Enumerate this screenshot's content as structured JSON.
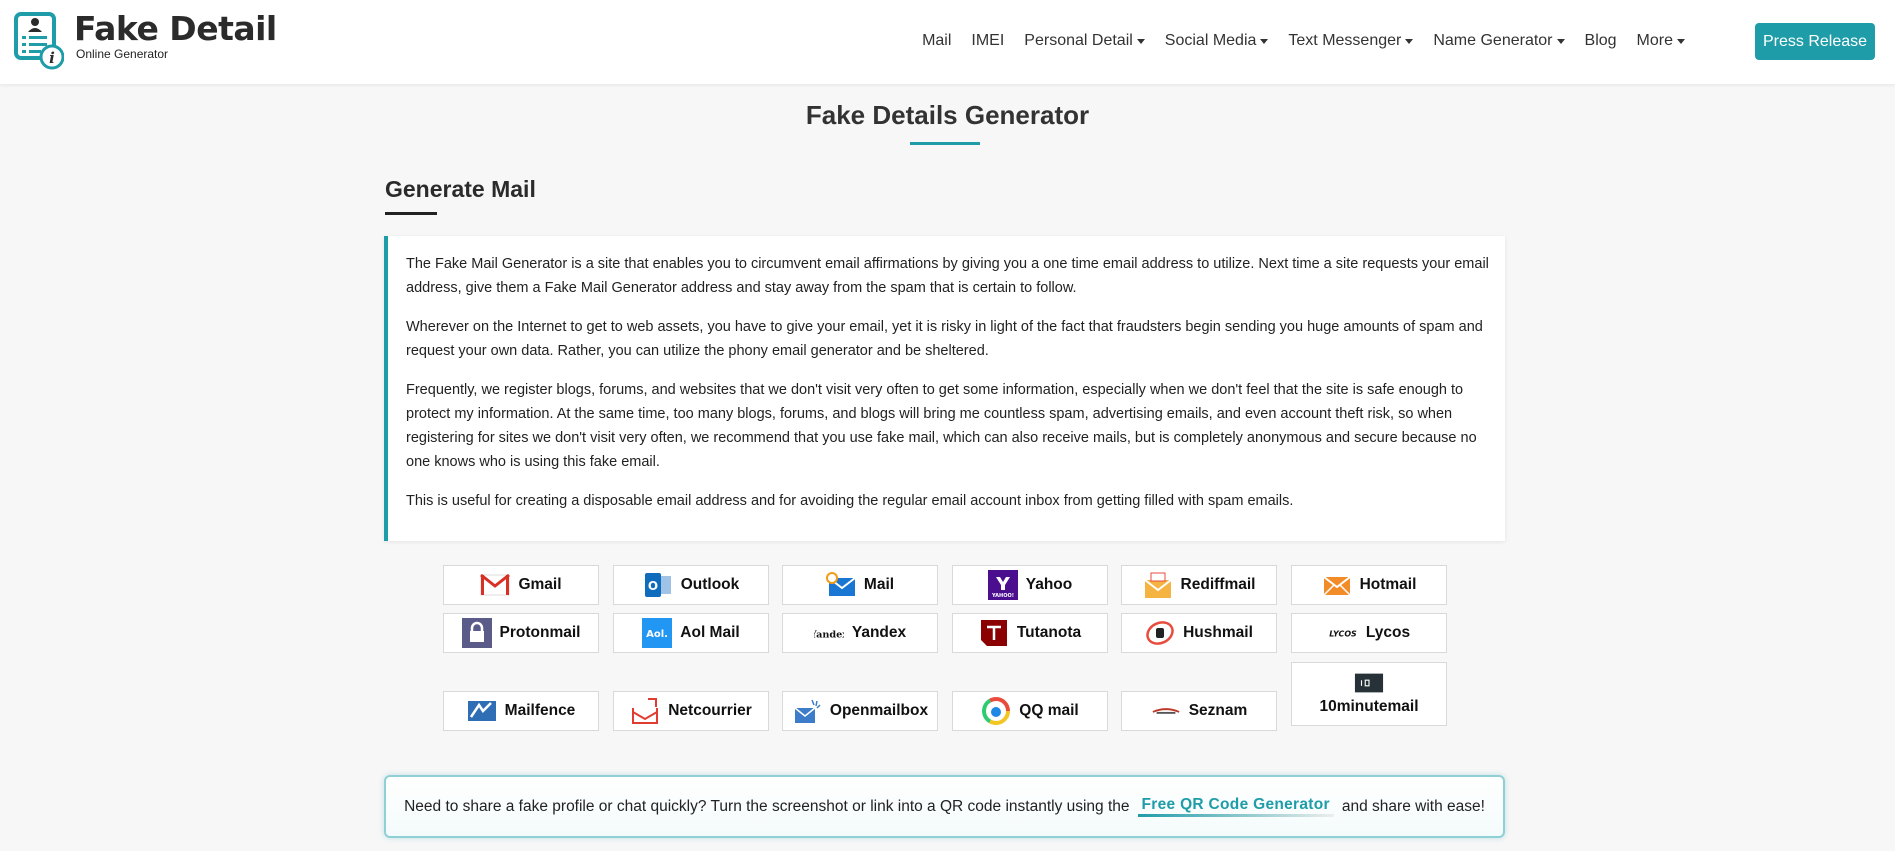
{
  "brand": {
    "title": "Fake Detail",
    "subtitle": "Online Generator"
  },
  "nav": {
    "items": [
      {
        "label": "Mail",
        "dropdown": false
      },
      {
        "label": "IMEI",
        "dropdown": false
      },
      {
        "label": "Personal Detail",
        "dropdown": true
      },
      {
        "label": "Social Media",
        "dropdown": true
      },
      {
        "label": "Text Messenger",
        "dropdown": true
      },
      {
        "label": "Name Generator",
        "dropdown": true
      },
      {
        "label": "Blog",
        "dropdown": false
      },
      {
        "label": "More",
        "dropdown": true
      }
    ],
    "press_release": "Press Release"
  },
  "page": {
    "title": "Fake Details Generator",
    "section_title": "Generate Mail"
  },
  "description": [
    "The Fake Mail Generator is a site that enables you to circumvent email affirmations by giving you a one time email address to utilize. Next time a site requests your email address, give them a Fake Mail Generator address and stay away from the spam that is certain to follow.",
    "Wherever on the Internet to get to web assets, you have to give your email, yet it is risky in light of the fact that fraudsters begin sending you huge amounts of spam and request your own data. Rather, you can utilize the phony email generator and be sheltered.",
    "Frequently, we register blogs, forums, and websites that we don't visit very often to get some information, especially when we don't feel that the site is safe enough to protect my information. At the same time, too many blogs, forums, and blogs will bring me countless spam, advertising emails, and even account theft risk, so when registering for sites we don't visit very often, we recommend that you use fake mail, which can also receive mails, but is completely anonymous and secure because no one knows who is using this fake email.",
    "This is useful for creating a disposable email address and for avoiding the regular email account inbox from getting filled with spam emails."
  ],
  "providers": [
    "Gmail",
    "Outlook",
    "Mail",
    "Yahoo",
    "Rediffmail",
    "Hotmail",
    "Protonmail",
    "Aol Mail",
    "Yandex",
    "Tutanota",
    "Hushmail",
    "Lycos",
    "Mailfence",
    "Netcourrier",
    "Openmailbox",
    "QQ mail",
    "Seznam",
    "10minutemail"
  ],
  "provider_logo_text": {
    "aol": "Aol.",
    "yandex": "Yandex",
    "lycos": "LYCOS",
    "yahoo": "YAHOO!"
  },
  "qr": {
    "before": "Need to share a fake profile or chat quickly? Turn the screenshot or link into a QR code instantly using the",
    "link": "Free QR Code Generator",
    "after": "and share with ease!"
  },
  "colors": {
    "accent": "#1e9ca8",
    "background": "#f7f7f7"
  }
}
